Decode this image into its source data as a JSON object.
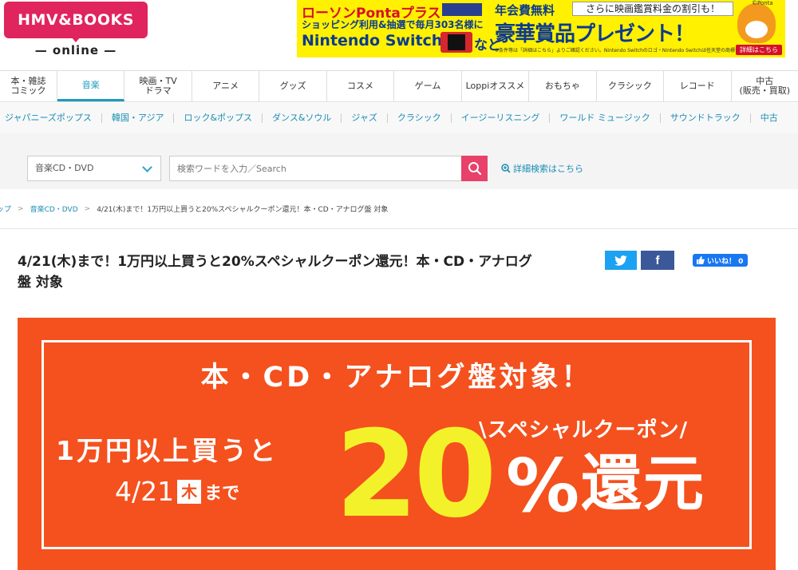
{
  "header": {
    "logo_main": "HMV&BOOKS",
    "logo_sub": "— online —"
  },
  "ad": {
    "line1": "ローソンPontaプラス",
    "line2": "ショッピング利用&抽選で毎月303名様に",
    "line3": "Nintendo Switch",
    "line3_suffix": "など",
    "line4": "年会費無料",
    "box": "さらに映画鑑賞料金の割引も！",
    "line5": "豪華賞品プレゼント！",
    "fine_print": "※条件等は「詳細はこちら」よりご確認ください。Nintendo Switchのロゴ・Nintendo Switchは任天堂の商標です。",
    "ponta": "©Ponta",
    "button": "詳細はこちら"
  },
  "mainnav": [
    {
      "label": "本・雑誌\nコミック",
      "active": false
    },
    {
      "label": "音楽",
      "active": true
    },
    {
      "label": "映画・TV\nドラマ",
      "active": false
    },
    {
      "label": "アニメ",
      "active": false
    },
    {
      "label": "グッズ",
      "active": false
    },
    {
      "label": "コスメ",
      "active": false
    },
    {
      "label": "ゲーム",
      "active": false
    },
    {
      "label": "Loppiオススメ",
      "active": false
    },
    {
      "label": "おもちゃ",
      "active": false
    },
    {
      "label": "クラシック",
      "active": false
    },
    {
      "label": "レコード",
      "active": false
    },
    {
      "label": "中古\n(販売・買取)",
      "active": false
    }
  ],
  "subnav": [
    "ジャパニーズポップス",
    "韓国・アジア",
    "ロック&ポップス",
    "ダンス&ソウル",
    "ジャズ",
    "クラシック",
    "イージーリスニング",
    "ワールド ミュージック",
    "サウンドトラック",
    "中古"
  ],
  "search": {
    "category": "音楽CD・DVD",
    "placeholder": "検索ワードを入力／Search",
    "advanced": "詳細検索はこちら"
  },
  "breadcrumb": {
    "items": [
      "ップ",
      "音楽CD・DVD"
    ],
    "separator": ">",
    "current": "4/21(木)まで！1万円以上買うと20%スペシャルクーポン還元！本・CD・アナログ盤 対象"
  },
  "article": {
    "title": "4/21(木)まで！1万円以上買うと20%スペシャルクーポン還元！本・CD・アナログ盤 対象"
  },
  "share": {
    "facebook": "f",
    "like": "いいね！ 0"
  },
  "hero": {
    "headline": "本・CD・アナログ盤対象！",
    "condition": "1万円以上買うと",
    "date": "4/21",
    "weekday": "木",
    "until": "まで",
    "special": "\\スペシャルクーポン/",
    "percent": "20",
    "percent_sign": "%",
    "kanji": "還元"
  },
  "colors": {
    "brand": "#e0245e",
    "accent": "#1a9bbf",
    "hero_bg": "#f4511e",
    "hero_yellow": "#f3f22a"
  }
}
